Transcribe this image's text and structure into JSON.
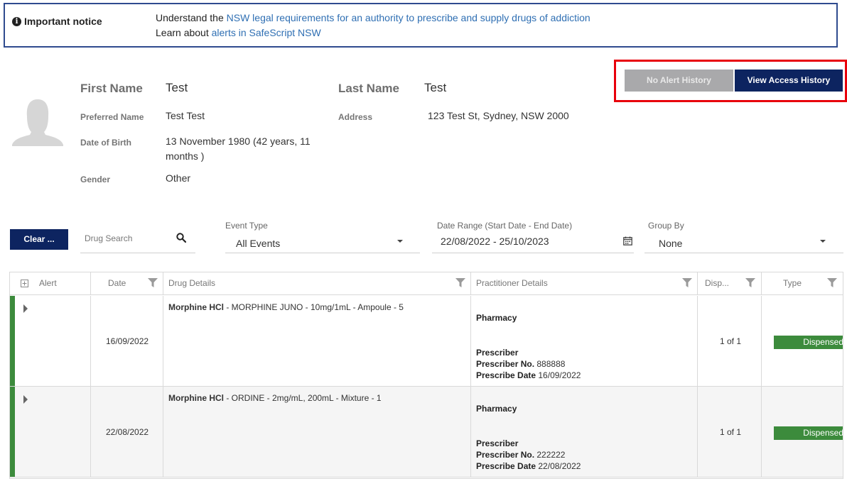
{
  "notice": {
    "title": "Important notice",
    "line1_prefix": "Understand the ",
    "line1_link": "NSW legal requirements for an authority to prescribe and supply drugs of addiction",
    "line2_prefix": "Learn about ",
    "line2_link": "alerts in SafeScript NSW"
  },
  "actions": {
    "no_alert_history": "No Alert History",
    "view_access_history": "View Access History"
  },
  "patient": {
    "first_name_label": "First Name",
    "first_name": "Test",
    "last_name_label": "Last Name",
    "last_name": "Test",
    "preferred_name_label": "Preferred Name",
    "preferred_name": "Test Test",
    "address_label": "Address",
    "address": "123 Test St, Sydney, NSW 2000",
    "dob_label": "Date of Birth",
    "dob_line1": "13 November 1980  (42 years, 11",
    "dob_line2": "months )",
    "gender_label": "Gender",
    "gender": "Other"
  },
  "filters": {
    "clear_label": "Clear ...",
    "drug_search_placeholder": "Drug Search",
    "event_type_label": "Event Type",
    "event_type_value": "All Events",
    "date_range_label": "Date Range (Start Date - End Date)",
    "date_range_value": "22/08/2022 - 25/10/2023",
    "group_by_label": "Group By",
    "group_by_value": "None"
  },
  "table": {
    "columns": [
      "Alert",
      "Date",
      "Drug Details",
      "Practitioner Details",
      "Disp...",
      "Type"
    ],
    "rows": [
      {
        "date": "16/09/2022",
        "drug_name": "Morphine HCl",
        "drug_rest": " - MORPHINE JUNO - 10mg/1mL - Ampoule - 5",
        "pharmacy": "Pharmacy",
        "prescriber": "Prescriber",
        "prescriber_no_label": "Prescriber No.",
        "prescriber_no": " 888888",
        "prescribe_date_label": "Prescribe Date",
        "prescribe_date": " 16/09/2022",
        "disp": "1 of 1",
        "type": "Dispensed"
      },
      {
        "date": "22/08/2022",
        "drug_name": "Morphine HCl",
        "drug_rest": " - ORDINE - 2mg/mL, 200mL - Mixture - 1",
        "pharmacy": "Pharmacy",
        "prescriber": "Prescriber",
        "prescriber_no_label": "Prescriber No.",
        "prescriber_no": " 222222",
        "prescribe_date_label": "Prescribe Date",
        "prescribe_date": " 22/08/2022",
        "disp": "1 of 1",
        "type": "Dispensed"
      }
    ]
  },
  "colors": {
    "navy": "#0d2460",
    "highlight": "#e8000b",
    "green": "#3c8b3c",
    "link": "#2f6fb3"
  }
}
